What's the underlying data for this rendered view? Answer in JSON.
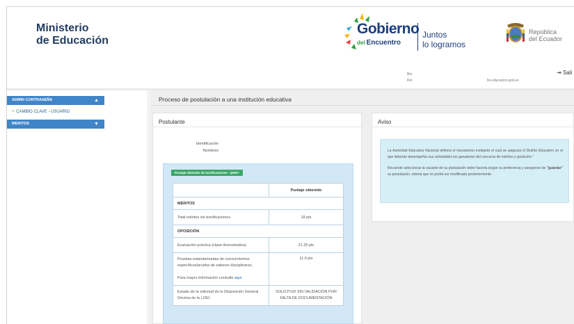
{
  "header": {
    "ministerio_line1": "Ministerio",
    "ministerio_line2": "de Educación",
    "gobierno_word": "Gobierno",
    "gobierno_del": "del",
    "gobierno_encuentro": "Encuentro",
    "juntos_line1": "Juntos",
    "juntos_line2": "lo logramos",
    "republica_line1": "República",
    "republica_line2": "del Ecuador",
    "user_line1": "Bie",
    "user_line2": "Rol",
    "site_url": "Ite.educacion.gob.ec",
    "salir_label": "Sali"
  },
  "sidebar": {
    "sections": [
      {
        "label": "ADMIN CONTRASEÑA",
        "chevron": "▲",
        "items": [
          {
            "label": "CAMBIO CLAVE - USUARIO"
          }
        ]
      },
      {
        "label": "MERITOS",
        "chevron": "▼"
      }
    ]
  },
  "main": {
    "page_title": "Proceso de postulación a una institución educativa",
    "postulante": {
      "title": "Postulante",
      "identificacion_label": "Identificación",
      "nombres_label": "Nombres",
      "badge": "Puntaje obtenido de bonificaciones - QSM?",
      "table": {
        "header_col2": "Puntaje obtenido",
        "meritos_section": "MÉRITOS",
        "meritos_row_label": "Total méritos sin bonificaciones",
        "meritos_row_value": "18 pts",
        "oposicion_section": "OPOSICIÓN",
        "evaluacion_label": "Evaluación práctica (clase demostrativa)",
        "evaluacion_value": "21.25 pts",
        "pruebas_label": "Pruebas estandarizadas de conocimientos específicos/prueba de saberes disciplinares.",
        "pruebas_value": "11.9 pts",
        "mas_info_text": "Para mayor información consulte",
        "mas_info_link": "aquí",
        "estado_label": "Estado de la solicitud de la Disposición General Décima de la LOEI",
        "estado_value": "SOLICITUD SIN VALIDACIÓN POR FALTA DE DOCUMENTACIÓN"
      }
    },
    "aviso": {
      "title": "Aviso",
      "paragraph1": "La Autoridad Educativa Nacional definirá el mecanismo mediante el cual se asignará el Distrito Educativo en el que deberán desempeñar sus actividades los ganadores del concurso de méritos y oposición.\"",
      "paragraph2_pre": "Recuerde seleccionar la vacante de su postulación debe hacerla según su preferencia y asegúrese de ",
      "paragraph2_bold": "\"guardar\"",
      "paragraph2_post": " su postulación, misma que no podrá ser modificada posteriormente."
    }
  },
  "colors": {
    "sidebar_header": "#3f85c8",
    "badge_green": "#3aa76a",
    "info_box": "#d3e8f6",
    "aviso_box": "#d6eef5",
    "brand_navy": "#1c3e7c"
  }
}
